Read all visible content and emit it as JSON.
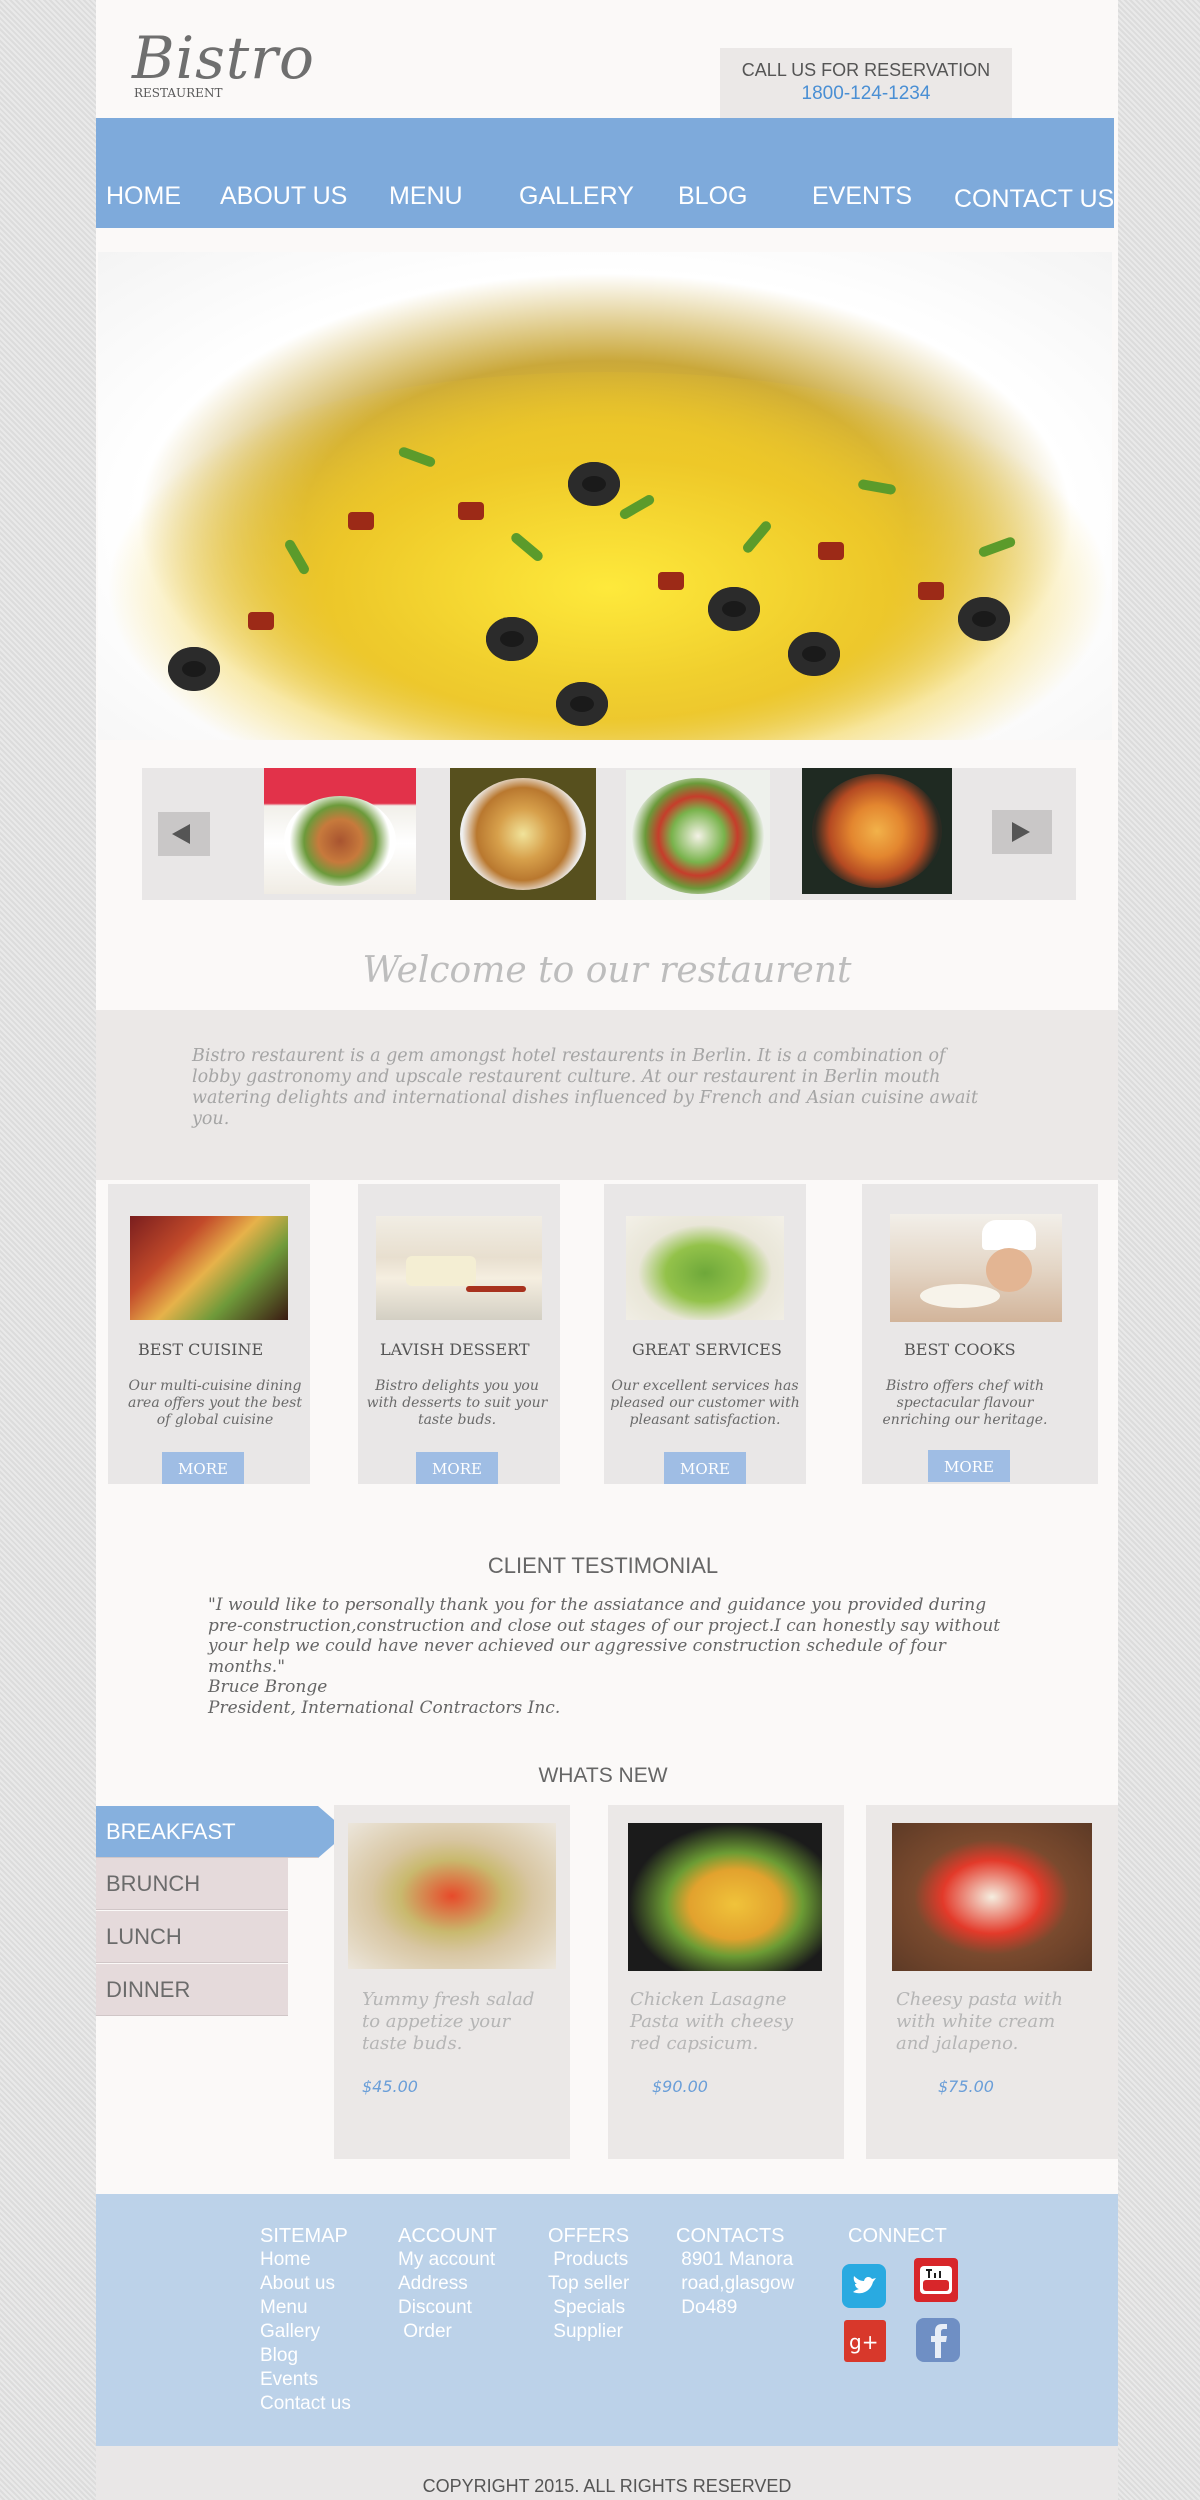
{
  "logo": {
    "title": "Bistro",
    "subtitle": "RESTAURENT"
  },
  "reservation": {
    "label": "CALL US FOR RESERVATION",
    "phone": "1800-124-1234"
  },
  "nav": {
    "items": [
      "HOME",
      "ABOUT US",
      "MENU",
      "GALLERY",
      "BLOG",
      "EVENTS",
      "CONTACT US"
    ]
  },
  "carousel": {
    "thumbnails": [
      "salmon-salad",
      "spiced-rice-dish",
      "vegetable-salad",
      "pizza-pan"
    ]
  },
  "welcome": {
    "heading": "Welcome to our restaurent",
    "text": "Bistro restaurent is a gem amongst hotel restaurents in Berlin. It is a combination of lobby gastronomy and upscale restaurent culture. At our restaurent in Berlin mouth watering delights and international dishes influenced by French and Asian cuisine await you."
  },
  "features": [
    {
      "title": "BEST CUISINE",
      "text": "Our multi-cuisine dining area offers yout the best of global cuisine",
      "button": "MORE"
    },
    {
      "title": "LAVISH DESSERT",
      "text": "Bistro delights you you with desserts to suit your taste buds.",
      "button": "MORE"
    },
    {
      "title": "GREAT SERVICES",
      "text": "Our excellent services has pleased our customer with pleasant satisfaction.",
      "button": "MORE"
    },
    {
      "title": "BEST COOKS",
      "text": "Bistro offers chef with spectacular flavour enriching our heritage.",
      "button": "MORE"
    }
  ],
  "testimonial": {
    "heading": "CLIENT TESTIMONIAL",
    "quote": "\"I would like to personally thank you for the assiatance and guidance you provided during pre-construction,construction and close out stages of our project.I can honestly say without your help we could have never achieved our aggressive construction schedule of four months.\"",
    "author": "Bruce Bronge",
    "role": "President, International Contractors Inc."
  },
  "whats_new": {
    "heading": "WHATS NEW",
    "tabs": [
      "BREAKFAST",
      "BRUNCH",
      "LUNCH",
      "DINNER"
    ],
    "active_tab": "BREAKFAST",
    "dishes": [
      {
        "text": "Yummy fresh salad\nto appetize your\ntaste buds.",
        "price": "$45.00"
      },
      {
        "text": "Chicken Lasagne\nPasta with cheesy\n red capsicum.",
        "price": "$90.00"
      },
      {
        "text": "Cheesy pasta with\nwith white cream\nand jalapeno.",
        "price": "$75.00"
      }
    ]
  },
  "footer": {
    "sitemap": {
      "heading": "SITEMAP",
      "links": [
        "Home",
        "About us",
        "Menu",
        "Gallery",
        "Blog",
        "Events",
        "Contact us"
      ]
    },
    "account": {
      "heading": "ACCOUNT",
      "links": [
        "My account",
        "Address",
        "Discount",
        " Order"
      ]
    },
    "offers": {
      "heading": "OFFERS",
      "links": [
        " Products",
        "Top seller",
        " Specials",
        " Supplier"
      ]
    },
    "contacts": {
      "heading": "CONTACTS",
      "lines": [
        " 8901 Manora",
        " road,glasgow",
        " Do489"
      ]
    },
    "connect": {
      "heading": "CONNECT",
      "icons": [
        "twitter-icon",
        "youtube-icon",
        "google-plus-icon",
        "facebook-icon"
      ]
    },
    "copyright": "COPYRIGHT 2015. ALL RIGHTS RESERVED"
  },
  "colors": {
    "accent": "#7eaadb",
    "footer": "#bcd2e9",
    "price": "#6a9ed8"
  }
}
